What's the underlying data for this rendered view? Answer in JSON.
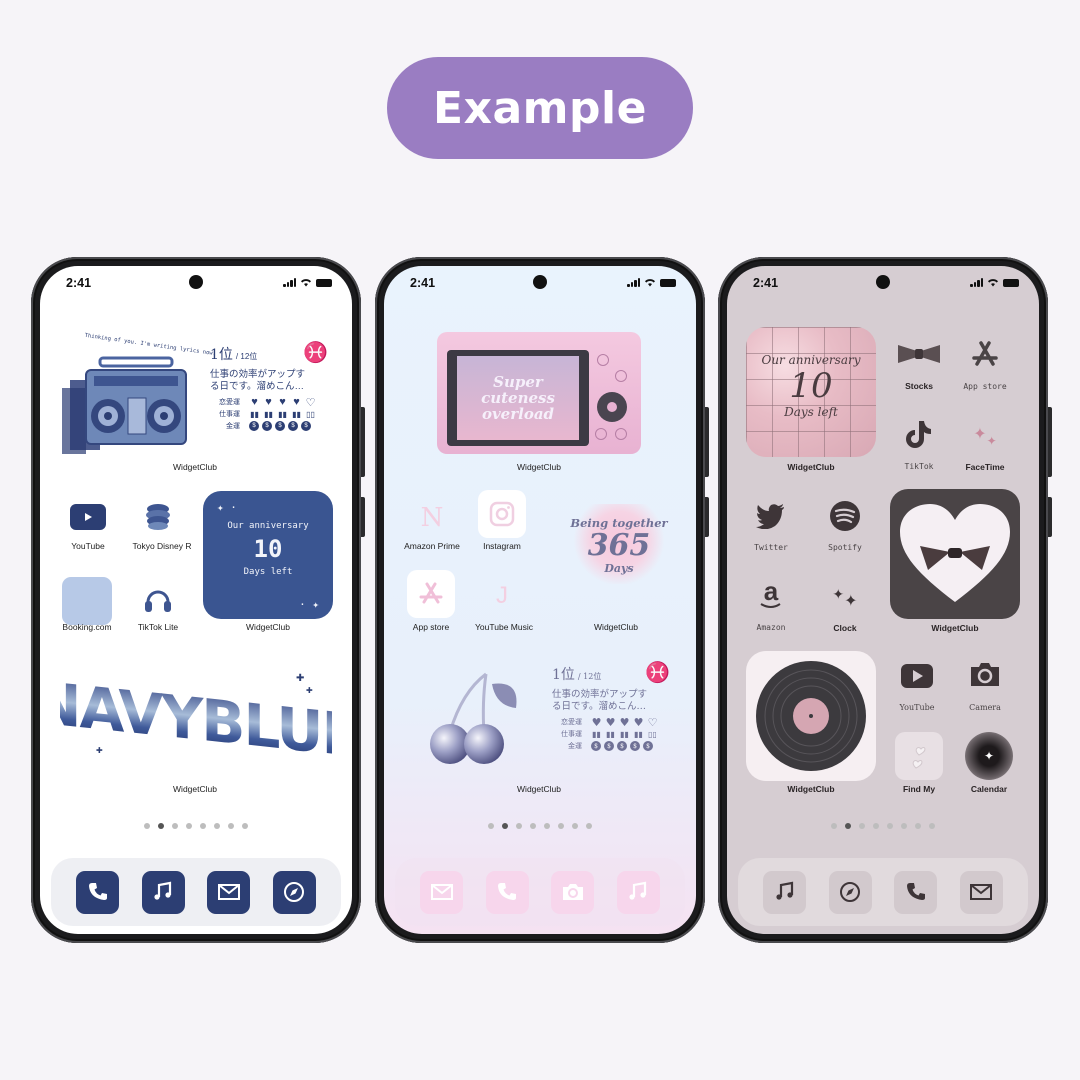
{
  "header": {
    "title": "Example",
    "accent": "#9a7dc2"
  },
  "phones": [
    {
      "theme": "navy",
      "status": {
        "time": "2:41"
      },
      "horoscope": {
        "rank": "1位",
        "total": "/ 12位",
        "sign": "♓",
        "text_line1": "仕事の効率がアップす",
        "text_line2": "る日です。溜めこん…",
        "rows": [
          {
            "label": "恋愛運",
            "score": 4,
            "max": 5
          },
          {
            "label": "仕事運",
            "score": 4,
            "max": 5
          },
          {
            "label": "金運",
            "score": 5,
            "max": 5
          }
        ]
      },
      "radio_caption": "Thinking of you. I'm writing lyrics now.",
      "widget1_label": "WidgetClub",
      "apps": [
        {
          "label": "YouTube"
        },
        {
          "label": "Tokyo Disney R"
        },
        {
          "label": "Booking.com"
        },
        {
          "label": "TikTok Lite"
        }
      ],
      "anniversary": {
        "title": "Our anniversary",
        "number": "10",
        "subtitle": "Days left",
        "label": "WidgetClub"
      },
      "banner": {
        "text": "NAVYBLUE",
        "label": "WidgetClub"
      },
      "page_dots": {
        "count": 8,
        "active": 2
      },
      "dock": [
        "phone",
        "music",
        "mail",
        "compass"
      ],
      "colors": {
        "primary": "#2c3e73",
        "background": "#ffffff"
      }
    },
    {
      "theme": "pastel",
      "status": {
        "time": "2:41"
      },
      "camera_widget": {
        "text": "Super cuteness overload",
        "label": "WidgetClub"
      },
      "apps": [
        {
          "label": "Amazon Prime"
        },
        {
          "label": "Instagram"
        },
        {
          "label": "App store"
        },
        {
          "label": "YouTube Music"
        }
      ],
      "together": {
        "title": "Being together",
        "number": "365",
        "subtitle": "Days",
        "label": "WidgetClub"
      },
      "horoscope": {
        "rank": "1位",
        "total": "/ 12位",
        "sign": "♓",
        "text_line1": "仕事の効率がアップす",
        "text_line2": "る日です。溜めこん…",
        "rows": [
          {
            "label": "恋愛運",
            "score": 4,
            "max": 5
          },
          {
            "label": "仕事運",
            "score": 4,
            "max": 5
          },
          {
            "label": "金運",
            "score": 5,
            "max": 5
          }
        ],
        "label": "WidgetClub"
      },
      "page_dots": {
        "count": 8,
        "active": 2
      },
      "dock": [
        "mail",
        "phone",
        "camera",
        "music"
      ],
      "colors": {
        "primary": "#6f7196",
        "background": "#e8f2fc",
        "dock_icon": "#f7d6ec"
      }
    },
    {
      "theme": "mauve",
      "status": {
        "time": "2:41"
      },
      "anniversary": {
        "title": "Our anniversary",
        "number": "10",
        "subtitle": "Days left",
        "label": "WidgetClub"
      },
      "apps_top": [
        {
          "label": "Stocks"
        },
        {
          "label": "App store"
        },
        {
          "label": "TikTok"
        },
        {
          "label": "FaceTime"
        }
      ],
      "apps_mid": [
        {
          "label": "Twitter"
        },
        {
          "label": "Spotify"
        },
        {
          "label": "Amazon"
        },
        {
          "label": "Clock"
        }
      ],
      "heart_widget": {
        "label": "WidgetClub"
      },
      "record_widget": {
        "label": "WidgetClub"
      },
      "apps_bottom": [
        {
          "label": "YouTube"
        },
        {
          "label": "Camera"
        },
        {
          "label": "Find My"
        },
        {
          "label": "Calendar"
        }
      ],
      "page_dots": {
        "count": 8,
        "active": 2
      },
      "dock": [
        "music",
        "compass",
        "phone",
        "mail"
      ],
      "colors": {
        "primary": "#4a4446",
        "background": "#d6cdd2"
      }
    }
  ]
}
